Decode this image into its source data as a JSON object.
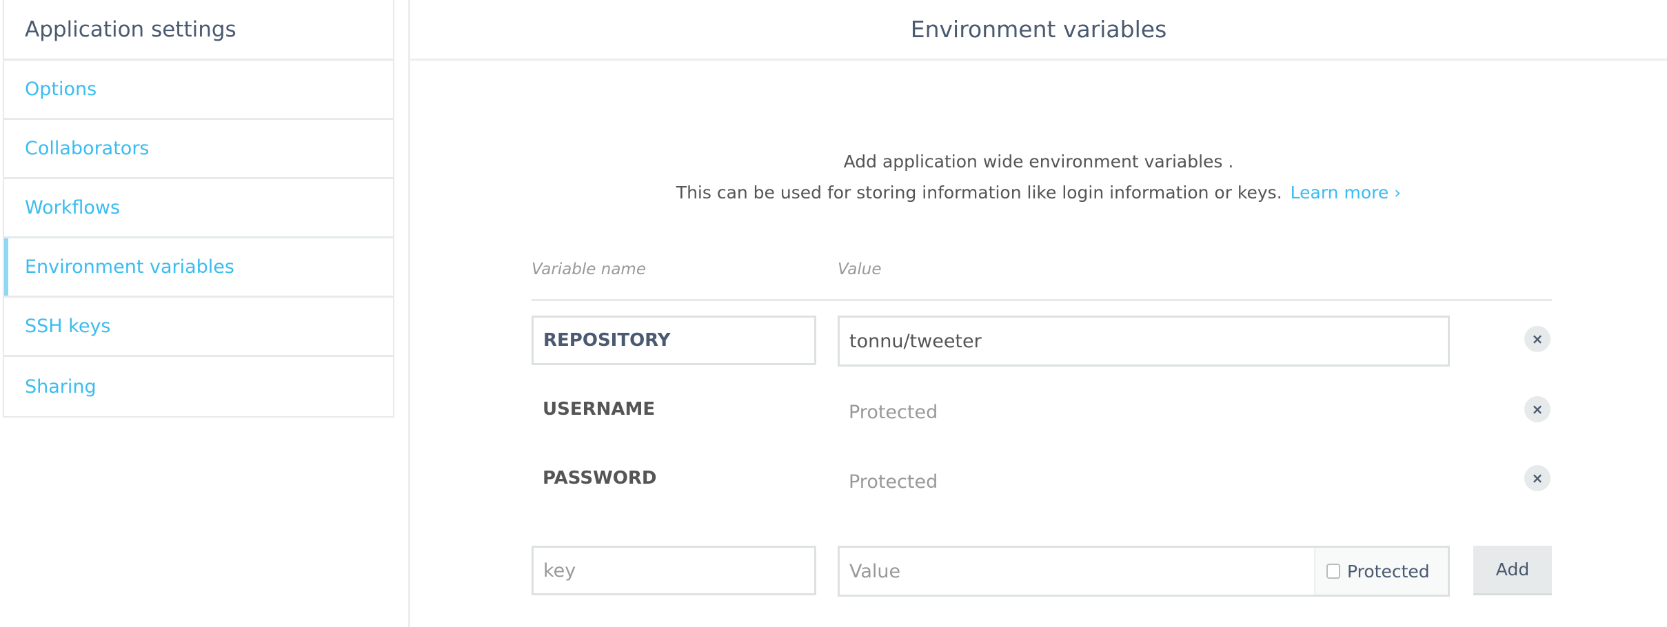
{
  "sidebar": {
    "title": "Application settings",
    "items": [
      {
        "label": "Options"
      },
      {
        "label": "Collaborators"
      },
      {
        "label": "Workflows"
      },
      {
        "label": "Environment variables",
        "active": true
      },
      {
        "label": "SSH keys"
      },
      {
        "label": "Sharing"
      }
    ]
  },
  "main": {
    "title": "Environment variables",
    "intro_line1": "Add application wide environment variables .",
    "intro_line2": "This can be used for storing information like login information or keys.",
    "learn_more": "Learn more ›",
    "col_name": "Variable name",
    "col_value": "Value",
    "rows": [
      {
        "key": "REPOSITORY",
        "value": "tonnu/tweeter"
      },
      {
        "key": "USERNAME",
        "value": "Protected"
      },
      {
        "key": "PASSWORD",
        "value": "Protected"
      }
    ],
    "delete_icon": "×",
    "new": {
      "key_placeholder": "key",
      "value_placeholder": "Value",
      "protected_label": "Protected",
      "add_label": "Add"
    }
  }
}
